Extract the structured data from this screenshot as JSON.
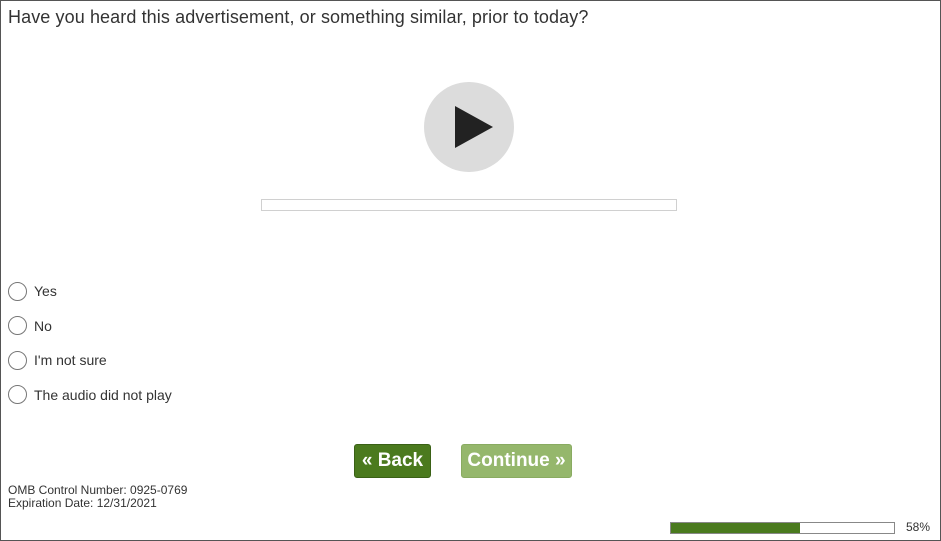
{
  "question": {
    "text": "Have you heard this advertisement, or something similar, prior to today?"
  },
  "audio_player": {
    "play_icon": "play-icon",
    "button_color": "#dcdcdc"
  },
  "options": [
    {
      "label": "Yes",
      "selected": false
    },
    {
      "label": "No",
      "selected": false
    },
    {
      "label": "I'm not sure",
      "selected": false
    },
    {
      "label": "The audio did not play",
      "selected": false
    }
  ],
  "navigation": {
    "back_label": "« Back",
    "continue_label": "Continue »",
    "continue_enabled": false
  },
  "footer": {
    "omb_control": "OMB Control Number: 0925-0769",
    "expiration": "Expiration Date: 12/31/2021"
  },
  "progress": {
    "percent": 58,
    "text": "58%"
  },
  "colors": {
    "accent": "#4b7a1e",
    "accent_disabled": "#95b76c"
  }
}
